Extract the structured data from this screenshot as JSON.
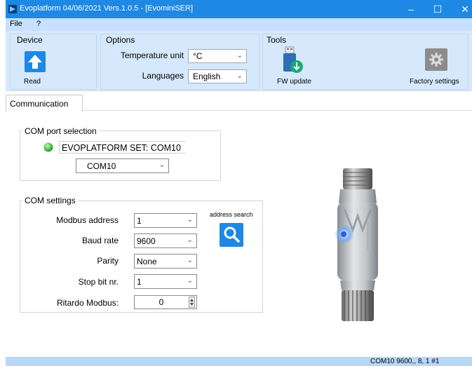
{
  "window": {
    "title": "Evoplatform 04/06/2021 Vers.1.0.5 - [EvominiSER]",
    "minimize": "–",
    "maximize": "☐",
    "close": "✕"
  },
  "menu": {
    "file": "File",
    "help": "?"
  },
  "ribbon": {
    "device": {
      "title": "Device",
      "read_label": "Read"
    },
    "options": {
      "title": "Options",
      "temperature_label": "Temperature unit",
      "temperature_value": "°C",
      "languages_label": "Languages",
      "language_value": "English"
    },
    "tools": {
      "title": "Tools",
      "fw_update_label": "FW update",
      "factory_settings_label": "Factory settings"
    }
  },
  "tabs": {
    "communication": "Communication"
  },
  "com_port": {
    "group_title": "COM port selection",
    "status_text": "EVOPLATFORM SET: COM10",
    "port_value": "COM10"
  },
  "com_settings": {
    "group_title": "COM settings",
    "modbus_address_label": "Modbus address",
    "modbus_address_value": "1",
    "baud_rate_label": "Baud rate",
    "baud_rate_value": "9600",
    "parity_label": "Parity",
    "parity_value": "None",
    "stop_bit_label": "Stop bit nr.",
    "stop_bit_value": "1",
    "ritardo_label": "Ritardo Modbus:",
    "ritardo_value": "0",
    "address_search_label": "address search"
  },
  "statusbar": {
    "text": "COM10 9600,, 8, 1 #1"
  },
  "colors": {
    "titlebar": "#1e88e5",
    "ribbon": "#d6e8fb",
    "status_led": "#3fbf3f",
    "search_button": "#1e88e5"
  },
  "icons": [
    "arrow-up-icon",
    "usb-download-icon",
    "gear-icon",
    "search-icon",
    "led-icon"
  ]
}
